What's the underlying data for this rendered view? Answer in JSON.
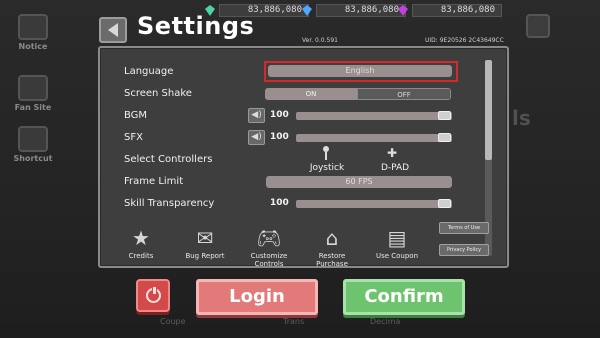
{
  "background": {
    "side_items": [
      {
        "label": "Notice",
        "icon": "notice-icon"
      },
      {
        "label": "Fan Site",
        "icon": "fan-site-icon"
      },
      {
        "label": "Shortcut",
        "icon": "shortcut-icon"
      }
    ],
    "ghost_right_text": "ls",
    "ghost_under": [
      "Coupe",
      "Trans",
      "Decima"
    ]
  },
  "currency": [
    {
      "icon": "green-gem-icon",
      "color": "#4fd2a0",
      "amount": "83,886,080"
    },
    {
      "icon": "blue-diamond-icon",
      "color": "#4aa8ff",
      "amount": "83,886,080"
    },
    {
      "icon": "purple-crystal-icon",
      "color": "#c040e0",
      "amount": "83,886,080"
    }
  ],
  "header": {
    "title": "Settings",
    "version": "Ver. 0.0.591",
    "uid": "UID: 9E20526 2C43649CC"
  },
  "settings": {
    "language": {
      "label": "Language",
      "value": "English"
    },
    "screen_shake": {
      "label": "Screen Shake",
      "on": "ON",
      "off": "OFF"
    },
    "bgm": {
      "label": "BGM",
      "value": "100",
      "level": 1.0
    },
    "sfx": {
      "label": "SFX",
      "value": "100",
      "level": 1.0
    },
    "select_controllers": {
      "label": "Select Controllers",
      "option1": "Joystick",
      "option2": "D-PAD"
    },
    "frame_limit": {
      "label": "Frame Limit",
      "value": "60 FPS"
    },
    "skill_transparency": {
      "label": "Skill Transparency",
      "value": "100",
      "level": 1.0
    }
  },
  "actions": {
    "credits": "Credits",
    "bug_report": "Bug Report",
    "customize_controls": "Customize Controls",
    "restore_purchase": "Restore Purchase",
    "use_coupon": "Use Coupon",
    "terms_of_use": "Terms of Use",
    "privacy": "Privacy Policy"
  },
  "footer": {
    "login": "Login",
    "confirm": "Confirm"
  },
  "colors": {
    "panel_bg": "#3e3e3e",
    "login": "#e27a7a",
    "confirm": "#6ec36e",
    "highlight": "#d42a2a"
  }
}
